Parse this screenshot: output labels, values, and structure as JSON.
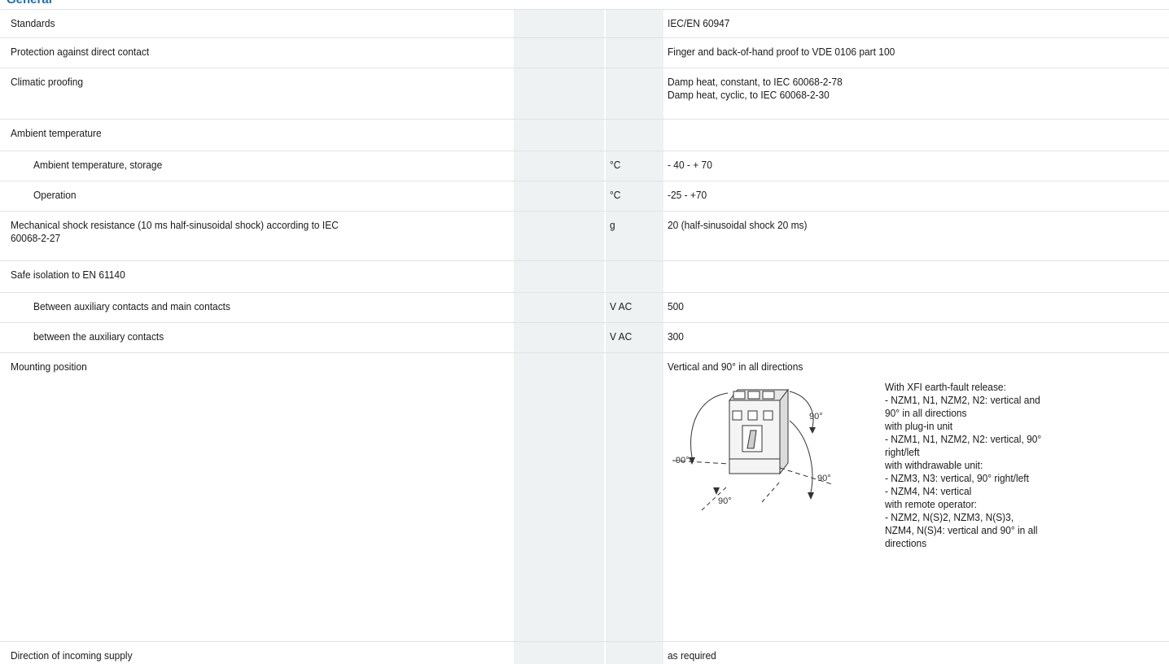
{
  "section": {
    "title": "General"
  },
  "rows": [
    {
      "label": "Standards",
      "unit": "",
      "value": "IEC/EN 60947"
    },
    {
      "label": "Protection against direct contact",
      "unit": "",
      "value": "Finger and back-of-hand proof to VDE 0106 part 100"
    },
    {
      "label": "Climatic proofing",
      "unit": "",
      "value": "Damp heat, constant, to IEC 60068-2-78\nDamp heat, cyclic, to IEC 60068-2-30"
    },
    {
      "label": "Ambient temperature",
      "unit": "",
      "value": ""
    },
    {
      "label": "Ambient temperature, storage",
      "unit": "°C",
      "value": "- 40 - + 70"
    },
    {
      "label": "Operation",
      "unit": "°C",
      "value": "-25 - +70"
    },
    {
      "label": "Mechanical shock resistance (10 ms half-sinusoidal shock) according to IEC\n60068-2-27",
      "unit": "g",
      "value": "20 (half-sinusoidal shock 20 ms)"
    },
    {
      "label": "Safe isolation to EN 61140",
      "unit": "",
      "value": ""
    },
    {
      "label": "Between auxiliary contacts and main contacts",
      "unit": "V AC",
      "value": "500"
    },
    {
      "label": "between the auxiliary contacts",
      "unit": "V AC",
      "value": "300"
    },
    {
      "label": "Mounting position",
      "unit": "",
      "value": "Vertical and 90° in all directions"
    },
    {
      "label": "Direction of incoming supply",
      "unit": "",
      "value": "as required"
    }
  ],
  "mounting": {
    "diagram_labels": {
      "top_right": "90°",
      "left": "90°",
      "front_left": "90°",
      "bottom": "90°",
      "right": "90°"
    },
    "notes": "With XFI earth-fault release:\n- NZM1, N1, NZM2, N2: vertical and\n90° in all directions\nwith plug-in unit\n- NZM1, N1, NZM2, N2: vertical, 90°\nright/left\nwith withdrawable unit:\n- NZM3, N3: vertical, 90° right/left\n- NZM4, N4: vertical\nwith remote operator:\n- NZM2, N(S)2, NZM3, N(S)3,\nNZM4, N(S)4: vertical and 90° in all\ndirections"
  },
  "colors": {
    "title": "#1a6fb5",
    "column_shade": "#eff2f3",
    "row_rule": "#dfe3e6"
  }
}
